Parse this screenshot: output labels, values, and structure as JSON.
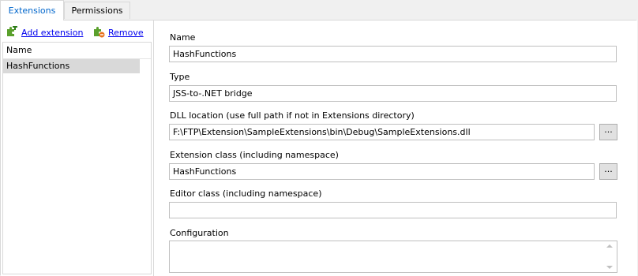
{
  "tabs": [
    {
      "label": "Extensions",
      "active": true
    },
    {
      "label": "Permissions",
      "active": false
    }
  ],
  "actions": {
    "add_label": "Add extension",
    "remove_label": "Remove",
    "add_icon": "puzzle-add-icon",
    "remove_icon": "puzzle-remove-icon"
  },
  "list": {
    "column_header": "Name",
    "items": [
      "HashFunctions"
    ],
    "selected": "HashFunctions"
  },
  "form": {
    "name_label": "Name",
    "name_value": "HashFunctions",
    "type_label": "Type",
    "type_value": "JSS-to-.NET bridge",
    "dll_label": "DLL location (use full path if not in Extensions directory)",
    "dll_value": "F:\\FTP\\Extension\\SampleExtensions\\bin\\Debug\\SampleExtensions.dll",
    "class_label": "Extension class (including namespace)",
    "class_value": "HashFunctions",
    "editor_label": "Editor class (including namespace)",
    "editor_value": "",
    "config_label": "Configuration",
    "config_value": "",
    "browse_label": "..."
  },
  "colors": {
    "active_tab_text": "#0066cc",
    "link": "#0000ee",
    "selection": "#d9d9d9",
    "icon_green": "#5aa02c"
  }
}
